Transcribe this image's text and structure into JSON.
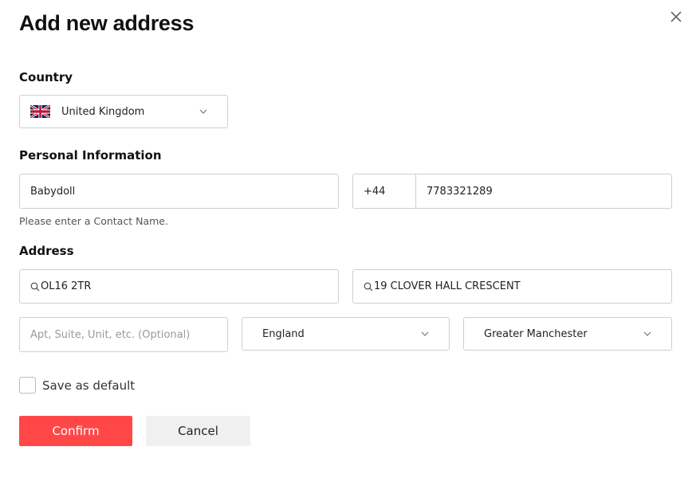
{
  "dialog": {
    "title": "Add new address",
    "close_icon": "close-icon"
  },
  "country": {
    "label": "Country",
    "selected": "United Kingdom",
    "flag_icon": "uk-flag-icon"
  },
  "personal": {
    "label": "Personal Information",
    "contact_name": "Babydoll",
    "phone_code": "+44",
    "phone_number": "7783321289",
    "hint": "Please enter a Contact Name."
  },
  "address": {
    "label": "Address",
    "postcode": "OL16 2TR",
    "street": "19 CLOVER HALL CRESCENT",
    "apt_placeholder": "Apt, Suite, Unit, etc. (Optional)",
    "region": "England",
    "county": "Greater Manchester"
  },
  "save_default": {
    "label": "Save as default",
    "checked": false
  },
  "actions": {
    "confirm_label": "Confirm",
    "cancel_label": "Cancel"
  },
  "colors": {
    "confirm_bg": "#ff4747",
    "cancel_bg": "#f0f0f0",
    "border": "#cfcfcf"
  }
}
